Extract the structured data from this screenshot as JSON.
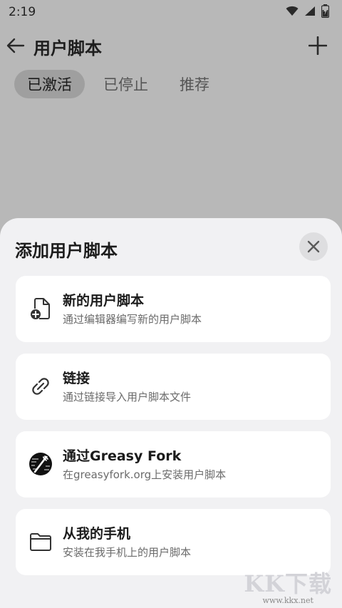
{
  "status_bar": {
    "time": "2:19"
  },
  "app_bar": {
    "title": "用户脚本"
  },
  "tabs": [
    {
      "label": "已激活",
      "active": true
    },
    {
      "label": "已停止",
      "active": false
    },
    {
      "label": "推荐",
      "active": false
    }
  ],
  "sheet": {
    "title": "添加用户脚本",
    "options": [
      {
        "label": "新的用户脚本",
        "desc": "通过编辑器编写新的用户脚本",
        "icon": "new-file-icon"
      },
      {
        "label": "链接",
        "desc": "通过链接导入用户脚本文件",
        "icon": "link-icon"
      },
      {
        "label": "通过Greasy Fork",
        "desc": "在greasyfork.org上安装用户脚本",
        "icon": "greasy-fork-icon"
      },
      {
        "label": "从我的手机",
        "desc": "安装在我手机上的用户脚本",
        "icon": "folder-icon"
      }
    ]
  },
  "watermark": {
    "brand": "KK下载",
    "url": "www.kkx.net"
  }
}
